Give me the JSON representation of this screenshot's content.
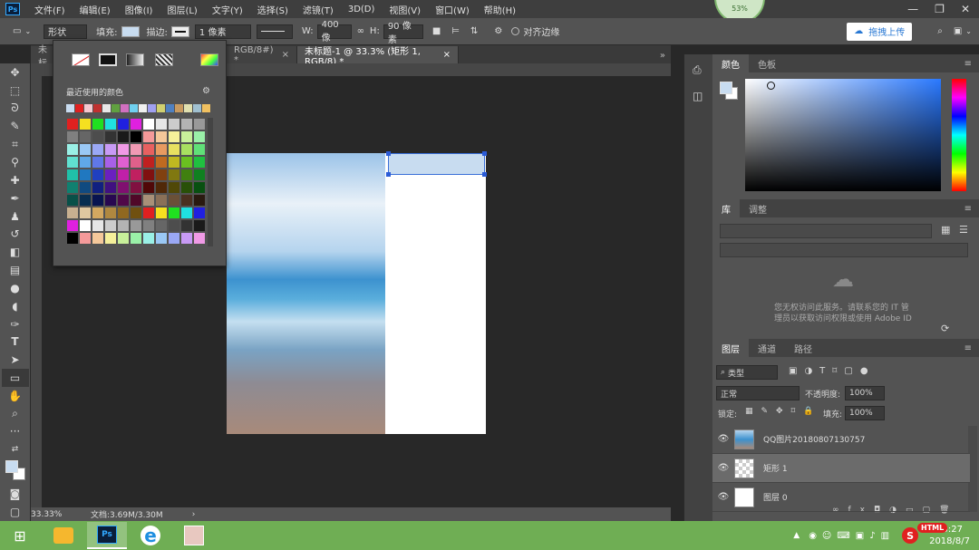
{
  "app": {
    "logo": "Ps",
    "ring_percent": "53%"
  },
  "menu": [
    "文件(F)",
    "编辑(E)",
    "图像(I)",
    "图层(L)",
    "文字(Y)",
    "选择(S)",
    "滤镜(T)",
    "3D(D)",
    "视图(V)",
    "窗口(W)",
    "帮助(H)"
  ],
  "options": {
    "mode": "形状",
    "fill_label": "填充:",
    "stroke_label": "描边:",
    "stroke_width": "1 像素",
    "w_label": "W:",
    "w_value": "400 像",
    "h_label": "H:",
    "h_value": "90 像素",
    "align_edges": "对齐边缘",
    "upload_label": "拖拽上传"
  },
  "tabs": [
    "未标",
    "RGB/8#) *",
    "未标题-1 @ 33.3% (矩形 1, RGB/8) *"
  ],
  "picker": {
    "recent_label": "最近使用的颜色"
  },
  "status": {
    "zoom": "33.33%",
    "doc": "文档:3.69M/3.30M"
  },
  "panels": {
    "color_tabs": [
      "颜色",
      "色板"
    ],
    "library_tabs": [
      "库",
      "调整"
    ],
    "library_msg_1": "您无权访问此服务。请联系您的 IT 管",
    "library_msg_2": "理员以获取访问权限或使用 Adobe ID",
    "layers_tabs": [
      "图层",
      "通道",
      "路径"
    ],
    "kind_label": "类型",
    "blend_mode": "正常",
    "opacity_label": "不透明度:",
    "opacity_value": "100%",
    "lock_label": "锁定:",
    "fill_label": "填充:",
    "fill_value": "100%"
  },
  "layers": [
    {
      "name": "QQ图片20180807130757"
    },
    {
      "name": "矩形 1"
    },
    {
      "name": "图层 0"
    }
  ],
  "taskbar": {
    "time": "13:27",
    "date": "2018/8/7",
    "html_badge": "HTML"
  }
}
